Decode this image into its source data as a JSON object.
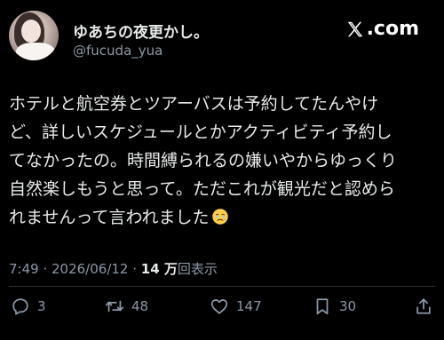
{
  "author": {
    "display_name": "ゆあちの夜更かし。",
    "handle": "@fucuda_yua"
  },
  "brand": {
    "label": ".com"
  },
  "tweet": {
    "lines": [
      "ホテルと航空券とツアーバスは予約してたんやけ",
      "ど、詳しいスケジュールとかアクティビティ予約し",
      "てなかったの。時間縛られるの嫌いやからゆっくり",
      "自然楽しもうと思って。ただこれが観光だと認めら",
      "れませんって言われました"
    ],
    "emoji": "face-holding-back-tears"
  },
  "meta": {
    "time": "7:49",
    "separator": " · ",
    "date": "2026/06/12",
    "views_count": "14 万",
    "views_label": "回表示"
  },
  "actions": {
    "replies": "3",
    "reposts": "48",
    "likes": "147",
    "bookmarks": "30"
  },
  "colors": {
    "background": "#000000",
    "text": "#e7e9ea",
    "secondary": "#8b98a5",
    "divider": "#2f3336"
  }
}
